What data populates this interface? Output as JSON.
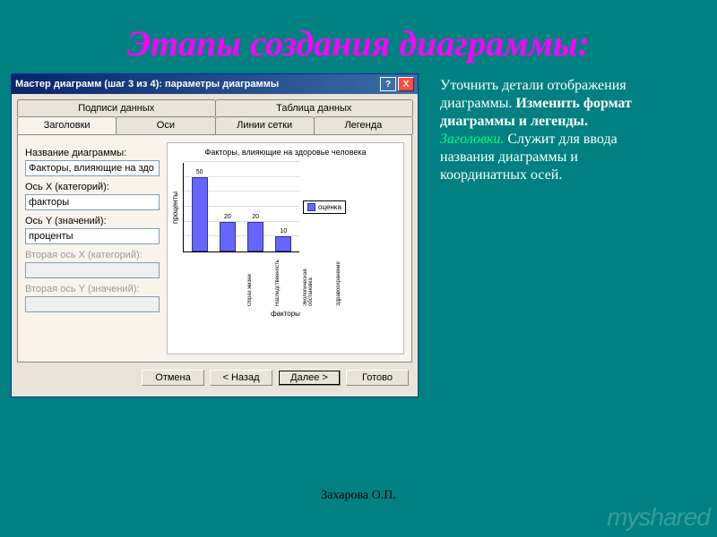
{
  "slide": {
    "title": "Этапы создания диаграммы:",
    "author": "Захарова О.П.",
    "watermark": "myshared"
  },
  "side": {
    "lead": "Уточнить детали отображения диаграммы. ",
    "bold": "Изменить формат диаграммы и легенды.",
    "hl": "Заголовки.",
    "tail": " Служит для ввода названия диаграммы и координатных осей."
  },
  "dialog": {
    "title": "Мастер диаграмм (шаг 3 из 4): параметры диаграммы",
    "help_icon": "?",
    "close_icon": "X",
    "tabs_top": [
      "Подписи данных",
      "Таблица данных"
    ],
    "tabs_bottom": [
      "Заголовки",
      "Оси",
      "Линии сетки",
      "Легенда"
    ],
    "active_tab": "Заголовки",
    "form": {
      "chart_title_label": "Название диаграммы:",
      "chart_title_value": "Факторы, влияющие на здо",
      "axis_x_label": "Ось X (категорий):",
      "axis_x_value": "факторы",
      "axis_y_label": "Ось Y (значений):",
      "axis_y_value": "проценты",
      "axis_x2_label": "Вторая ось X (категорий):",
      "axis_x2_value": "",
      "axis_y2_label": "Вторая ось Y (значений):",
      "axis_y2_value": ""
    },
    "buttons": {
      "cancel": "Отмена",
      "back": "< Назад",
      "next": "Далее >",
      "finish": "Готово"
    }
  },
  "chart_data": {
    "type": "bar",
    "title": "Факторы, влияющие на здоровье человека",
    "xlabel": "факторы",
    "ylabel": "проценты",
    "legend": "оценка",
    "ylim": [
      0,
      60
    ],
    "categories": [
      "Образ жизни",
      "Наследственность",
      "Экологическая обстановка",
      "Здравоохранение"
    ],
    "values": [
      50,
      20,
      20,
      10
    ],
    "grid": [
      10,
      20,
      30,
      40,
      50,
      60
    ]
  }
}
